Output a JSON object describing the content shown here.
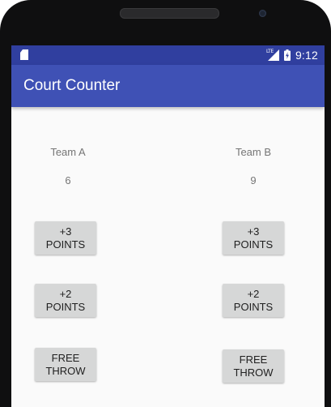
{
  "status_bar": {
    "network_label": "LTE",
    "time": "9:12"
  },
  "app_bar": {
    "title": "Court Counter"
  },
  "team_a": {
    "name": "Team A",
    "score": "6",
    "buttons": {
      "plus3": "+3\nPOINTS",
      "plus2": "+2\nPOINTS",
      "free_throw": "FREE\nTHROW"
    }
  },
  "team_b": {
    "name": "Team B",
    "score": "9",
    "buttons": {
      "plus3": "+3\nPOINTS",
      "plus2": "+2\nPOINTS",
      "free_throw": "FREE\nTHROW"
    }
  },
  "colors": {
    "status_bar": "#303f9f",
    "app_bar": "#3f51b5",
    "button": "#d6d7d7",
    "background": "#fafafa"
  },
  "icons": {
    "sim": "sim-card-icon",
    "signal": "cell-signal-icon",
    "battery": "battery-charging-icon"
  }
}
